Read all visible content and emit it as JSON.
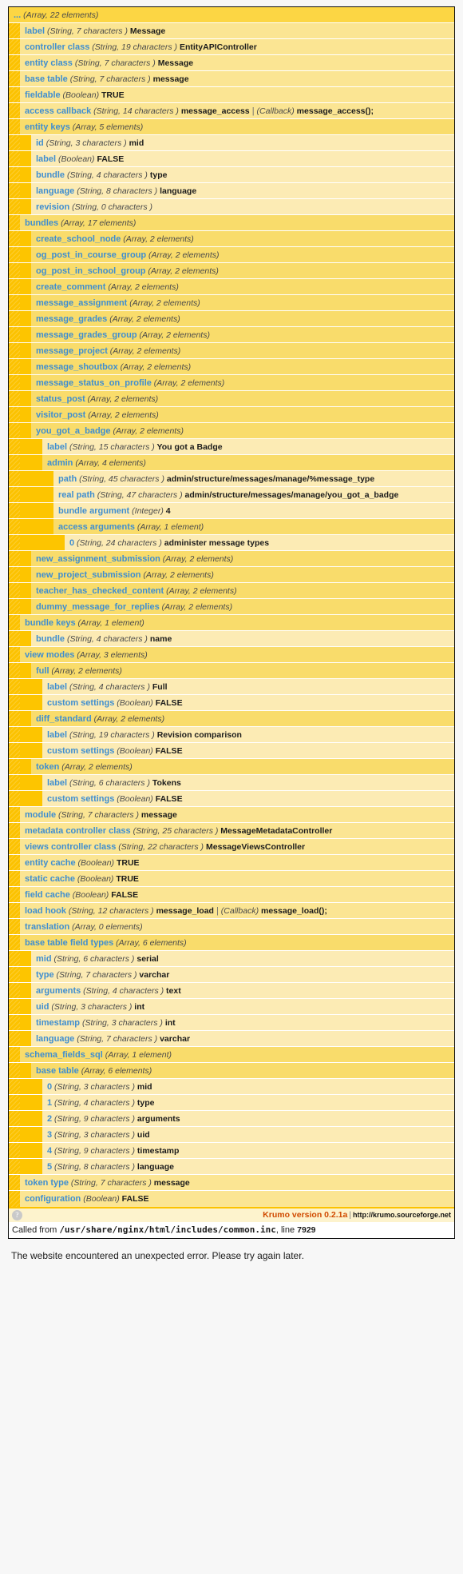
{
  "footer": {
    "help_icon": "question-mark-icon",
    "version_label": "Krumo version 0.2.1a",
    "pipe": "|",
    "url": "http://krumo.sourceforge.net",
    "called_from_prefix": "Called from",
    "called_from_path": "/usr/share/nginx/html/includes/common.inc",
    "called_from_line_prefix": ", line",
    "called_from_line": "7929"
  },
  "error_message": "The website encountered an unexpected error. Please try again later.",
  "colors": {
    "header": "#FCD644",
    "row_light": "#FBE593",
    "row_mid": "#F9DC6B",
    "row_pale": "#FCEBB4",
    "guide": "#FCC200",
    "key": "#3F8ED0",
    "value": "#1B1B1B",
    "version": "#D04A00"
  },
  "tree": [
    {
      "depth": 0,
      "shade": "sh-head",
      "key": "...",
      "meta": "(Array, 22 elements)",
      "value": ""
    },
    {
      "depth": 1,
      "shade": "sh-a",
      "key": "label",
      "meta": "(String, 7 characters )",
      "value": "Message"
    },
    {
      "depth": 1,
      "shade": "sh-a",
      "key": "controller class",
      "meta": "(String, 19 characters )",
      "value": "EntityAPIController"
    },
    {
      "depth": 1,
      "shade": "sh-a",
      "key": "entity class",
      "meta": "(String, 7 characters )",
      "value": "Message"
    },
    {
      "depth": 1,
      "shade": "sh-a",
      "key": "base table",
      "meta": "(String, 7 characters )",
      "value": "message"
    },
    {
      "depth": 1,
      "shade": "sh-a",
      "key": "fieldable",
      "meta": "(Boolean)",
      "value": "TRUE"
    },
    {
      "depth": 1,
      "shade": "sh-a",
      "key": "access callback",
      "meta": "(String, 14 characters )",
      "value": "message_access",
      "sep": "|",
      "meta2": "(Callback)",
      "value2": "message_access();"
    },
    {
      "depth": 1,
      "shade": "sh-b",
      "key": "entity keys",
      "meta": "(Array, 5 elements)",
      "value": ""
    },
    {
      "depth": 2,
      "shade": "sh-c",
      "key": "id",
      "meta": "(String, 3 characters )",
      "value": "mid"
    },
    {
      "depth": 2,
      "shade": "sh-c",
      "key": "label",
      "meta": "(Boolean)",
      "value": "FALSE"
    },
    {
      "depth": 2,
      "shade": "sh-c",
      "key": "bundle",
      "meta": "(String, 4 characters )",
      "value": "type"
    },
    {
      "depth": 2,
      "shade": "sh-c",
      "key": "language",
      "meta": "(String, 8 characters )",
      "value": "language"
    },
    {
      "depth": 2,
      "shade": "sh-c",
      "key": "revision",
      "meta": "(String, 0 characters )",
      "value": ""
    },
    {
      "depth": 1,
      "shade": "sh-b",
      "key": "bundles",
      "meta": "(Array, 17 elements)",
      "value": ""
    },
    {
      "depth": 2,
      "shade": "sh-b",
      "key": "create_school_node",
      "meta": "(Array, 2 elements)",
      "value": ""
    },
    {
      "depth": 2,
      "shade": "sh-b",
      "key": "og_post_in_course_group",
      "meta": "(Array, 2 elements)",
      "value": ""
    },
    {
      "depth": 2,
      "shade": "sh-b",
      "key": "og_post_in_school_group",
      "meta": "(Array, 2 elements)",
      "value": ""
    },
    {
      "depth": 2,
      "shade": "sh-b",
      "key": "create_comment",
      "meta": "(Array, 2 elements)",
      "value": ""
    },
    {
      "depth": 2,
      "shade": "sh-b",
      "key": "message_assignment",
      "meta": "(Array, 2 elements)",
      "value": ""
    },
    {
      "depth": 2,
      "shade": "sh-b",
      "key": "message_grades",
      "meta": "(Array, 2 elements)",
      "value": ""
    },
    {
      "depth": 2,
      "shade": "sh-b",
      "key": "message_grades_group",
      "meta": "(Array, 2 elements)",
      "value": ""
    },
    {
      "depth": 2,
      "shade": "sh-b",
      "key": "message_project",
      "meta": "(Array, 2 elements)",
      "value": ""
    },
    {
      "depth": 2,
      "shade": "sh-b",
      "key": "message_shoutbox",
      "meta": "(Array, 2 elements)",
      "value": ""
    },
    {
      "depth": 2,
      "shade": "sh-b",
      "key": "message_status_on_profile",
      "meta": "(Array, 2 elements)",
      "value": ""
    },
    {
      "depth": 2,
      "shade": "sh-b",
      "key": "status_post",
      "meta": "(Array, 2 elements)",
      "value": ""
    },
    {
      "depth": 2,
      "shade": "sh-b",
      "key": "visitor_post",
      "meta": "(Array, 2 elements)",
      "value": ""
    },
    {
      "depth": 2,
      "shade": "sh-b",
      "key": "you_got_a_badge",
      "meta": "(Array, 2 elements)",
      "value": ""
    },
    {
      "depth": 3,
      "shade": "sh-c",
      "key": "label",
      "meta": "(String, 15 characters )",
      "value": "You got a Badge"
    },
    {
      "depth": 3,
      "shade": "sh-b",
      "key": "admin",
      "meta": "(Array, 4 elements)",
      "value": ""
    },
    {
      "depth": 4,
      "shade": "sh-c",
      "key": "path",
      "meta": "(String, 45 characters )",
      "value": "admin/structure/messages/manage/%message_type"
    },
    {
      "depth": 4,
      "shade": "sh-c",
      "key": "real path",
      "meta": "(String, 47 characters )",
      "value": "admin/structure/messages/manage/you_got_a_badge"
    },
    {
      "depth": 4,
      "shade": "sh-c",
      "key": "bundle argument",
      "meta": "(Integer)",
      "value": "4"
    },
    {
      "depth": 4,
      "shade": "sh-b",
      "key": "access arguments",
      "meta": "(Array, 1 element)",
      "value": ""
    },
    {
      "depth": 5,
      "shade": "sh-c",
      "key": "0",
      "meta": "(String, 24 characters )",
      "value": "administer message types"
    },
    {
      "depth": 2,
      "shade": "sh-b",
      "key": "new_assignment_submission",
      "meta": "(Array, 2 elements)",
      "value": ""
    },
    {
      "depth": 2,
      "shade": "sh-b",
      "key": "new_project_submission",
      "meta": "(Array, 2 elements)",
      "value": ""
    },
    {
      "depth": 2,
      "shade": "sh-b",
      "key": "teacher_has_checked_content",
      "meta": "(Array, 2 elements)",
      "value": ""
    },
    {
      "depth": 2,
      "shade": "sh-b",
      "key": "dummy_message_for_replies",
      "meta": "(Array, 2 elements)",
      "value": ""
    },
    {
      "depth": 1,
      "shade": "sh-b",
      "key": "bundle keys",
      "meta": "(Array, 1 element)",
      "value": ""
    },
    {
      "depth": 2,
      "shade": "sh-c",
      "key": "bundle",
      "meta": "(String, 4 characters )",
      "value": "name"
    },
    {
      "depth": 1,
      "shade": "sh-b",
      "key": "view modes",
      "meta": "(Array, 3 elements)",
      "value": ""
    },
    {
      "depth": 2,
      "shade": "sh-b",
      "key": "full",
      "meta": "(Array, 2 elements)",
      "value": ""
    },
    {
      "depth": 3,
      "shade": "sh-c",
      "key": "label",
      "meta": "(String, 4 characters )",
      "value": "Full"
    },
    {
      "depth": 3,
      "shade": "sh-c",
      "key": "custom settings",
      "meta": "(Boolean)",
      "value": "FALSE"
    },
    {
      "depth": 2,
      "shade": "sh-b",
      "key": "diff_standard",
      "meta": "(Array, 2 elements)",
      "value": ""
    },
    {
      "depth": 3,
      "shade": "sh-c",
      "key": "label",
      "meta": "(String, 19 characters )",
      "value": "Revision comparison"
    },
    {
      "depth": 3,
      "shade": "sh-c",
      "key": "custom settings",
      "meta": "(Boolean)",
      "value": "FALSE"
    },
    {
      "depth": 2,
      "shade": "sh-b",
      "key": "token",
      "meta": "(Array, 2 elements)",
      "value": ""
    },
    {
      "depth": 3,
      "shade": "sh-c",
      "key": "label",
      "meta": "(String, 6 characters )",
      "value": "Tokens"
    },
    {
      "depth": 3,
      "shade": "sh-c",
      "key": "custom settings",
      "meta": "(Boolean)",
      "value": "FALSE"
    },
    {
      "depth": 1,
      "shade": "sh-a",
      "key": "module",
      "meta": "(String, 7 characters )",
      "value": "message"
    },
    {
      "depth": 1,
      "shade": "sh-a",
      "key": "metadata controller class",
      "meta": "(String, 25 characters )",
      "value": "MessageMetadataController"
    },
    {
      "depth": 1,
      "shade": "sh-a",
      "key": "views controller class",
      "meta": "(String, 22 characters )",
      "value": "MessageViewsController"
    },
    {
      "depth": 1,
      "shade": "sh-a",
      "key": "entity cache",
      "meta": "(Boolean)",
      "value": "TRUE"
    },
    {
      "depth": 1,
      "shade": "sh-a",
      "key": "static cache",
      "meta": "(Boolean)",
      "value": "TRUE"
    },
    {
      "depth": 1,
      "shade": "sh-a",
      "key": "field cache",
      "meta": "(Boolean)",
      "value": "FALSE"
    },
    {
      "depth": 1,
      "shade": "sh-a",
      "key": "load hook",
      "meta": "(String, 12 characters )",
      "value": "message_load",
      "sep": "|",
      "meta2": "(Callback)",
      "value2": "message_load();"
    },
    {
      "depth": 1,
      "shade": "sh-a",
      "key": "translation",
      "meta": "(Array, 0 elements)",
      "value": ""
    },
    {
      "depth": 1,
      "shade": "sh-b",
      "key": "base table field types",
      "meta": "(Array, 6 elements)",
      "value": ""
    },
    {
      "depth": 2,
      "shade": "sh-c",
      "key": "mid",
      "meta": "(String, 6 characters )",
      "value": "serial"
    },
    {
      "depth": 2,
      "shade": "sh-c",
      "key": "type",
      "meta": "(String, 7 characters )",
      "value": "varchar"
    },
    {
      "depth": 2,
      "shade": "sh-c",
      "key": "arguments",
      "meta": "(String, 4 characters )",
      "value": "text"
    },
    {
      "depth": 2,
      "shade": "sh-c",
      "key": "uid",
      "meta": "(String, 3 characters )",
      "value": "int"
    },
    {
      "depth": 2,
      "shade": "sh-c",
      "key": "timestamp",
      "meta": "(String, 3 characters )",
      "value": "int"
    },
    {
      "depth": 2,
      "shade": "sh-c",
      "key": "language",
      "meta": "(String, 7 characters )",
      "value": "varchar"
    },
    {
      "depth": 1,
      "shade": "sh-b",
      "key": "schema_fields_sql",
      "meta": "(Array, 1 element)",
      "value": ""
    },
    {
      "depth": 2,
      "shade": "sh-b",
      "key": "base table",
      "meta": "(Array, 6 elements)",
      "value": ""
    },
    {
      "depth": 3,
      "shade": "sh-c",
      "key": "0",
      "meta": "(String, 3 characters )",
      "value": "mid"
    },
    {
      "depth": 3,
      "shade": "sh-c",
      "key": "1",
      "meta": "(String, 4 characters )",
      "value": "type"
    },
    {
      "depth": 3,
      "shade": "sh-c",
      "key": "2",
      "meta": "(String, 9 characters )",
      "value": "arguments"
    },
    {
      "depth": 3,
      "shade": "sh-c",
      "key": "3",
      "meta": "(String, 3 characters )",
      "value": "uid"
    },
    {
      "depth": 3,
      "shade": "sh-c",
      "key": "4",
      "meta": "(String, 9 characters )",
      "value": "timestamp"
    },
    {
      "depth": 3,
      "shade": "sh-c",
      "key": "5",
      "meta": "(String, 8 characters )",
      "value": "language"
    },
    {
      "depth": 1,
      "shade": "sh-a",
      "key": "token type",
      "meta": "(String, 7 characters )",
      "value": "message"
    },
    {
      "depth": 1,
      "shade": "sh-a",
      "key": "configuration",
      "meta": "(Boolean)",
      "value": "FALSE"
    }
  ]
}
